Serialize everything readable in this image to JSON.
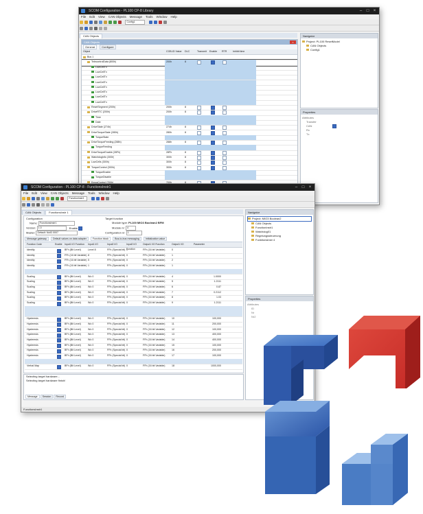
{
  "back_window": {
    "title": "SCOM Configuration - PL100 CP-8 Library",
    "menu": [
      "File",
      "Edit",
      "View",
      "CAN Objects",
      "Message",
      "Tools",
      "Window",
      "Help"
    ],
    "toolbar_combo": "Config1",
    "doc_tab": "CAN Objects",
    "dialog_title": "CAN Objects",
    "subtabs": [
      "General",
      "Configure"
    ],
    "columns": [
      "Object",
      "COB-ID Value",
      "DLC",
      "Transmit",
      "Enable",
      "RTR",
      "Inhibit time"
    ],
    "rows": [
      {
        "indent": 0,
        "label": "Bus 1",
        "kind": "fold",
        "cob": "",
        "dlc": "",
        "highlight": false,
        "enable": null,
        "rtr": false
      },
      {
        "indent": 1,
        "label": "TelecontrolData (800h)",
        "kind": "fold",
        "cob": "200h",
        "dlc": "8",
        "highlight": true,
        "enable": true,
        "rtr": false
      },
      {
        "indent": 2,
        "label": "LowCellTx",
        "kind": "leaf",
        "cob": "",
        "dlc": "",
        "highlight": true,
        "enable": null,
        "rtr": null
      },
      {
        "indent": 2,
        "label": "LowCellTx",
        "kind": "leaf",
        "cob": "",
        "dlc": "",
        "highlight": true,
        "enable": null,
        "rtr": null
      },
      {
        "indent": 2,
        "label": "LowCellTx",
        "kind": "leaf",
        "cob": "",
        "dlc": "",
        "highlight": true,
        "enable": null,
        "rtr": null
      },
      {
        "indent": 2,
        "label": "LowCellTx",
        "kind": "leaf",
        "cob": "",
        "dlc": "",
        "highlight": true,
        "enable": null,
        "rtr": null
      },
      {
        "indent": 2,
        "label": "LowCellTx",
        "kind": "leaf",
        "cob": "",
        "dlc": "",
        "highlight": true,
        "enable": null,
        "rtr": null
      },
      {
        "indent": 2,
        "label": "LowCellTx",
        "kind": "leaf",
        "cob": "",
        "dlc": "",
        "highlight": true,
        "enable": null,
        "rtr": null
      },
      {
        "indent": 2,
        "label": "LowCellTx",
        "kind": "leaf",
        "cob": "",
        "dlc": "",
        "highlight": true,
        "enable": null,
        "rtr": null
      },
      {
        "indent": 2,
        "label": "LowCellTx",
        "kind": "leaf",
        "cob": "",
        "dlc": "",
        "highlight": true,
        "enable": null,
        "rtr": null
      },
      {
        "indent": 1,
        "label": "ResetSegment (200h)",
        "kind": "fold",
        "cob": "200h",
        "dlc": "8",
        "highlight": false,
        "enable": true,
        "rtr": false
      },
      {
        "indent": 1,
        "label": "DriveRTC (200h)",
        "kind": "fold",
        "cob": "200h",
        "dlc": "8",
        "highlight": false,
        "enable": true,
        "rtr": false
      },
      {
        "indent": 2,
        "label": "Time",
        "kind": "leaf",
        "cob": "",
        "dlc": "",
        "highlight": true,
        "enable": null,
        "rtr": null
      },
      {
        "indent": 2,
        "label": "Date",
        "kind": "leaf",
        "cob": "",
        "dlc": "",
        "highlight": true,
        "enable": null,
        "rtr": null
      },
      {
        "indent": 1,
        "label": "DriveState (274h)",
        "kind": "fold",
        "cob": "274h",
        "dlc": "8",
        "highlight": false,
        "enable": true,
        "rtr": false
      },
      {
        "indent": 1,
        "label": "DriveTorqueState (280h)",
        "kind": "fold",
        "cob": "280h",
        "dlc": "8",
        "highlight": false,
        "enable": true,
        "rtr": false
      },
      {
        "indent": 2,
        "label": "TorqueState",
        "kind": "leaf",
        "cob": "",
        "dlc": "",
        "highlight": true,
        "enable": null,
        "rtr": null
      },
      {
        "indent": 1,
        "label": "DriveTorqueFeeding (288h)",
        "kind": "fold",
        "cob": "288h",
        "dlc": "8",
        "highlight": false,
        "enable": true,
        "rtr": false
      },
      {
        "indent": 2,
        "label": "TorqueFeeding",
        "kind": "leaf",
        "cob": "",
        "dlc": "",
        "highlight": true,
        "enable": null,
        "rtr": null
      },
      {
        "indent": 1,
        "label": "DriveTorqueEnable (28Fh)",
        "kind": "fold",
        "cob": "28Fh",
        "dlc": "8",
        "highlight": false,
        "enable": true,
        "rtr": false
      },
      {
        "indent": 1,
        "label": "WatchdogInfo (300h)",
        "kind": "fold",
        "cob": "300h",
        "dlc": "8",
        "highlight": false,
        "enable": true,
        "rtr": false
      },
      {
        "indent": 1,
        "label": "LowCells (300h)",
        "kind": "fold",
        "cob": "300h",
        "dlc": "8",
        "highlight": false,
        "enable": true,
        "rtr": false
      },
      {
        "indent": 1,
        "label": "TorqueControl (300h)",
        "kind": "fold",
        "cob": "300h",
        "dlc": "8",
        "highlight": false,
        "enable": true,
        "rtr": false
      },
      {
        "indent": 2,
        "label": "TorqueEnable",
        "kind": "leaf",
        "cob": "",
        "dlc": "",
        "highlight": true,
        "enable": null,
        "rtr": null
      },
      {
        "indent": 2,
        "label": "TorqueDisable",
        "kind": "leaf",
        "cob": "",
        "dlc": "",
        "highlight": true,
        "enable": null,
        "rtr": null
      },
      {
        "indent": 1,
        "label": "EmpaControl (700h)",
        "kind": "fold",
        "cob": "700h",
        "dlc": "8",
        "highlight": false,
        "enable": true,
        "rtr": false
      },
      {
        "indent": 0,
        "label": "Bus 2",
        "kind": "fold",
        "cob": "",
        "dlc": "",
        "highlight": false,
        "enable": null,
        "rtr": false
      },
      {
        "indent": 1,
        "label": "Simulation (274h)",
        "kind": "fold",
        "cob": "200h",
        "dlc": "8",
        "highlight": false,
        "enable": true,
        "rtr": false
      }
    ],
    "explorer_title": "Navigator",
    "explorer_items": [
      "Project: PL100 ResetModel",
      "CAN Objects",
      "Config1"
    ],
    "props_title": "Properties",
    "props_lines": [
      "Attributes",
      "Transfer",
      "CAN",
      "Rx",
      "Tx"
    ]
  },
  "front_window": {
    "title": "SCOM Configuration - PL100 CP-8 - FunctionsInstr1",
    "menu": [
      "File",
      "Edit",
      "View",
      "CAN Objects",
      "Message",
      "Tools",
      "Window",
      "Help"
    ],
    "toolbar_combo": "FunctionInstr1",
    "doc_tabs": [
      "CAN Objects",
      "FunctionsInstr 1"
    ],
    "config_label": "Configuration",
    "name_label": "Name:",
    "name_value": "FunctionsInstr1",
    "version_label": "Version:",
    "version_value": "1.0",
    "enable_label": "Enable",
    "master_label": "Master:",
    "master_value": "Default: NoID 0007",
    "target_label": "Target function",
    "module_type_label": "Module type:",
    "module_type_value": "PL100 MIO3 Boolean2 BFM",
    "module_nr_label": "Module nr:",
    "module_nr_value": "4",
    "config_nr_label": "Configuration nr:",
    "config_nr_value": "1",
    "subtabs": [
      "Message gateway",
      "Default values on data adapter",
      "Function block",
      "Bus-to-bus messaging",
      "Initialization value"
    ],
    "columns": [
      "Function Code",
      "Enable",
      "Input1 I/O Function",
      "Input1 I/O",
      "Input2 I/O",
      "Input2 I/O Function",
      "Output1 I/O Function",
      "Output1 I/O",
      "Parameter"
    ],
    "rows": [
      {
        "a": "Identity",
        "b": true,
        "c": "BFh (Bit Level)",
        "d": "Level 8",
        "e": "FFh (Special bit)",
        "f": "0",
        "g": "FFh (16 bit Variable)",
        "h": "0",
        "i": "",
        "blank": false
      },
      {
        "a": "Identity",
        "b": true,
        "c": "FFh (16 bit Variable)",
        "d": "8",
        "e": "FFh (Special bit)",
        "f": "0",
        "g": "FFh (16 bit Variable)",
        "h": "1",
        "i": "",
        "blank": false
      },
      {
        "a": "Identity",
        "b": true,
        "c": "FFh (16 bit Variable)",
        "d": "5",
        "e": "FFh (Special bit)",
        "f": "0",
        "g": "FFh (16 bit Variable)",
        "h": "2",
        "i": "",
        "blank": false
      },
      {
        "a": "Identity",
        "b": true,
        "c": "FFh (16 bit Variable)",
        "d": "1",
        "e": "FFh (Special bit)",
        "f": "0",
        "g": "FFh (16 bit Variable)",
        "h": "1",
        "i": "",
        "blank": false
      },
      {
        "a": "",
        "b": null,
        "c": "",
        "d": "",
        "e": "",
        "f": "",
        "g": "",
        "h": "",
        "i": "",
        "blank": true
      },
      {
        "a": "Scaling",
        "b": true,
        "c": "BFh (Bit Level)",
        "d": "Wo 0",
        "e": "FFh (Special bit)",
        "f": "0",
        "g": "FFh (16 bit Variable)",
        "h": "4",
        "i": "1.0000",
        "blank": false
      },
      {
        "a": "Scaling",
        "b": true,
        "c": "BFh (Bit Level)",
        "d": "Wo 0",
        "e": "FFh (Special bit)",
        "f": "0",
        "g": "FFh (16 bit Variable)",
        "h": "5",
        "i": "1.2111",
        "blank": false
      },
      {
        "a": "Scaling",
        "b": true,
        "c": "BFh (Bit Level)",
        "d": "Wo 0",
        "e": "FFh (Special bit)",
        "f": "0",
        "g": "FFh (16 bit Variable)",
        "h": "6",
        "i": "0.87",
        "blank": false
      },
      {
        "a": "Scaling",
        "b": true,
        "c": "BFh (Bit Level)",
        "d": "Wo 0",
        "e": "FFh (Special bit)",
        "f": "0",
        "g": "FFh (16 bit Variable)",
        "h": "7",
        "i": "0.2112",
        "blank": false
      },
      {
        "a": "Scaling",
        "b": true,
        "c": "BFh (Bit Level)",
        "d": "Wo 0",
        "e": "FFh (Special bit)",
        "f": "0",
        "g": "FFh (16 bit Variable)",
        "h": "8",
        "i": "1.03",
        "blank": false
      },
      {
        "a": "Scaling",
        "b": true,
        "c": "BFh (Bit Level)",
        "d": "Wo 0",
        "e": "FFh (Special bit)",
        "f": "0",
        "g": "FFh (16 bit Variable)",
        "h": "9",
        "i": "1.2111",
        "blank": false
      },
      {
        "a": "",
        "b": null,
        "c": "",
        "d": "",
        "e": "",
        "f": "",
        "g": "",
        "h": "",
        "i": "",
        "blank": true
      },
      {
        "a": "",
        "b": null,
        "c": "",
        "d": "",
        "e": "",
        "f": "",
        "g": "",
        "h": "",
        "i": "",
        "blank": true
      },
      {
        "a": "Hysteresis",
        "b": true,
        "c": "BFh (Bit Level)",
        "d": "Wo 0",
        "e": "FFh (Special bit)",
        "f": "0",
        "g": "FFh (16 bit Variable)",
        "h": "10",
        "i": "100,000",
        "blank": false
      },
      {
        "a": "Hysteresis",
        "b": true,
        "c": "BFh (Bit Level)",
        "d": "Wo 0",
        "e": "FFh (Special bit)",
        "f": "0",
        "g": "FFh (16 bit Variable)",
        "h": "11",
        "i": "200,000",
        "blank": false
      },
      {
        "a": "Hysteresis",
        "b": true,
        "c": "BFh (Bit Level)",
        "d": "Wo 0",
        "e": "FFh (Special bit)",
        "f": "0",
        "g": "FFh (16 bit Variable)",
        "h": "12",
        "i": "100,000",
        "blank": false
      },
      {
        "a": "Hysteresis",
        "b": true,
        "c": "BFh (Bit Level)",
        "d": "Wo 0",
        "e": "FFh (Special bit)",
        "f": "0",
        "g": "FFh (16 bit Variable)",
        "h": "13",
        "i": "400,000",
        "blank": false
      },
      {
        "a": "Hysteresis",
        "b": true,
        "c": "BFh (Bit Level)",
        "d": "Wo 0",
        "e": "FFh (Special bit)",
        "f": "0",
        "g": "FFh (16 bit Variable)",
        "h": "14",
        "i": "400,000",
        "blank": false
      },
      {
        "a": "Hysteresis",
        "b": true,
        "c": "BFh (Bit Level)",
        "d": "Wo 0",
        "e": "FFh (Special bit)",
        "f": "0",
        "g": "FFh (16 bit Variable)",
        "h": "15",
        "i": "100,000",
        "blank": false
      },
      {
        "a": "Hysteresis",
        "b": true,
        "c": "BFh (Bit Level)",
        "d": "Wo 0",
        "e": "FFh (Special bit)",
        "f": "0",
        "g": "FFh (16 bit Variable)",
        "h": "16",
        "i": "200,000",
        "blank": false
      },
      {
        "a": "Hysteresis",
        "b": true,
        "c": "BFh (Bit Level)",
        "d": "Wo 0",
        "e": "FFh (Special bit)",
        "f": "0",
        "g": "FFh (16 bit Variable)",
        "h": "17",
        "i": "100,000",
        "blank": false
      },
      {
        "a": "",
        "b": null,
        "c": "",
        "d": "",
        "e": "",
        "f": "",
        "g": "",
        "h": "",
        "i": "",
        "blank": true
      },
      {
        "a": "Verbal Map",
        "b": true,
        "c": "BFh (Bit Level)",
        "d": "Wo 0",
        "e": "FFh (Special bit)",
        "f": "0",
        "g": "FFh (16 bit Variable)",
        "h": "18",
        "i": "1000,000",
        "blank": false
      }
    ],
    "output_lines": [
      "Selecting target hardware...",
      "Selecting target hardware finish!"
    ],
    "bottom_tabs": [
      "Message",
      "Session",
      "Record"
    ],
    "status_text": "FunctionsInstr1",
    "explorer_title": "Navigator",
    "explorer_items": [
      "Project: MIO3 Boolean2",
      "CAN Objects",
      "FunctionInstr1",
      "Watchdog01",
      "Regelungssteuerung",
      "Funktionsinstr 4"
    ],
    "props_title": "Properties",
    "props_lines": [
      "Attributes",
      "ID",
      "Nr",
      "Nr2"
    ]
  },
  "logo": {
    "colors": {
      "blue_dark": "#2c56a8",
      "blue_mid": "#3e6fc2",
      "blue_light": "#6b98d6",
      "red": "#c42a26"
    }
  }
}
